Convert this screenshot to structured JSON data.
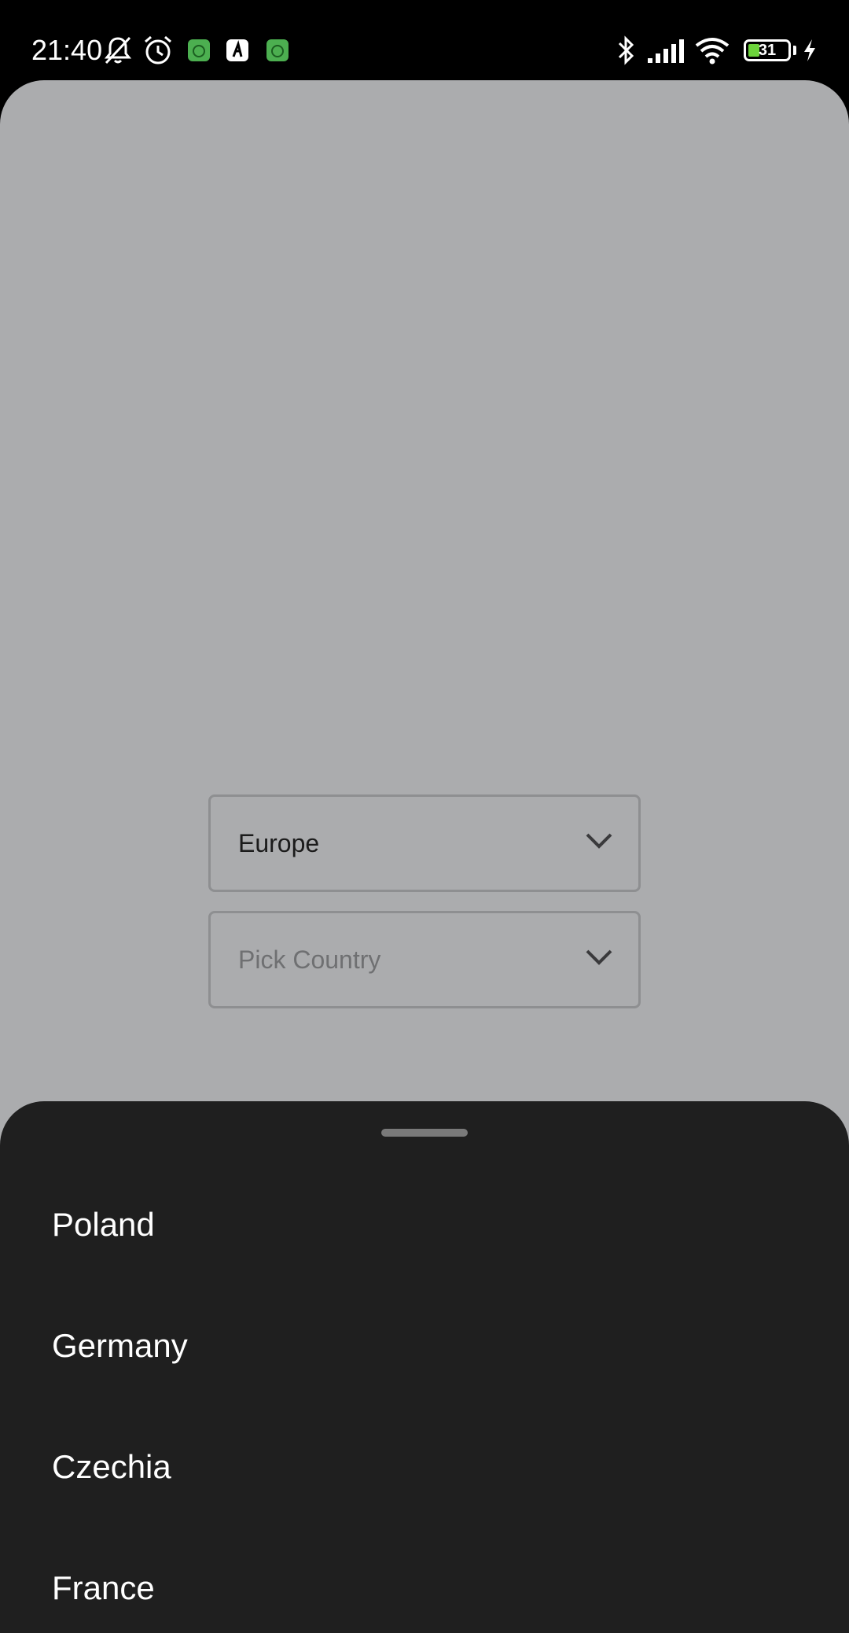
{
  "status_bar": {
    "time": "21:40",
    "battery_level": "31",
    "icons": [
      "bell-off-icon",
      "alarm-icon",
      "app-notification-icon",
      "app-notification-icon",
      "app-notification-icon",
      "bluetooth-icon",
      "cell-signal-icon",
      "wifi-icon",
      "battery-icon",
      "charging-icon"
    ],
    "colors": {
      "app_badge_green": "#4caf50",
      "battery_fill": "#6cd33b"
    }
  },
  "form": {
    "region": {
      "value": "Europe"
    },
    "country": {
      "placeholder": "Pick Country"
    }
  },
  "sheet": {
    "items": [
      {
        "label": "Poland"
      },
      {
        "label": "Germany"
      },
      {
        "label": "Czechia"
      },
      {
        "label": "France"
      }
    ]
  },
  "colors": {
    "scrim_surface": "#abacae",
    "sheet_background": "#1f1f1f",
    "sheet_text": "#ffffff"
  }
}
